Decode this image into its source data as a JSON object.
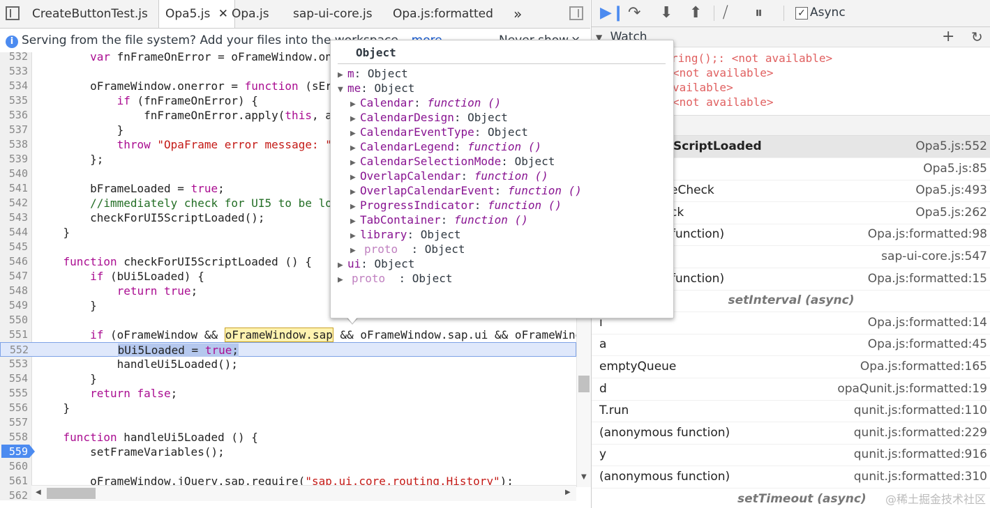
{
  "tabs": [
    "CreateButtonTest.js",
    "Opa5.js",
    "Opa.js",
    "sap-ui-core.js",
    "Opa.js:formatted"
  ],
  "tab_overflow": "»",
  "infobar": {
    "text": "Serving from the file system? Add your files into the workspace.",
    "link": "more",
    "never_show": "Never show",
    "close": "×"
  },
  "editor": {
    "lines": [
      {
        "n": "532",
        "code": "        var fnFrameOnError = oFrameWindow.onerror;"
      },
      {
        "n": "533",
        "code": ""
      },
      {
        "n": "534",
        "code": "        oFrameWindow.onerror = function (sErrorMsg, sUrl, iLine) {"
      },
      {
        "n": "535",
        "code": "            if (fnFrameOnError) {"
      },
      {
        "n": "536",
        "code": "                fnFrameOnError.apply(this, arguments);"
      },
      {
        "n": "537",
        "code": "            }"
      },
      {
        "n": "538",
        "code": "            throw \"OpaFrame error message: \" + sErrorMsg;"
      },
      {
        "n": "539",
        "code": "        };"
      },
      {
        "n": "540",
        "code": ""
      },
      {
        "n": "541",
        "code": "        bFrameLoaded = true;"
      },
      {
        "n": "542",
        "code": "        //immediately check for UI5 to be loaded, to intercept any hashchanges"
      },
      {
        "n": "543",
        "code": "        checkForUI5ScriptLoaded();"
      },
      {
        "n": "544",
        "code": "    }"
      },
      {
        "n": "545",
        "code": ""
      },
      {
        "n": "546",
        "code": "    function checkForUI5ScriptLoaded () {"
      },
      {
        "n": "547",
        "code": "        if (bUi5Loaded) {"
      },
      {
        "n": "548",
        "code": "            return true;"
      },
      {
        "n": "549",
        "code": "        }"
      },
      {
        "n": "550",
        "code": ""
      },
      {
        "n": "551",
        "code": "        if (oFrameWindow && oFrameWindow.sap && oFrameWindow.sap.ui && oFrameWindow.sap.ui.getCore) {"
      },
      {
        "n": "552",
        "code": "            bUi5Loaded = true;"
      },
      {
        "n": "553",
        "code": "            handleUi5Loaded();"
      },
      {
        "n": "554",
        "code": "        }"
      },
      {
        "n": "555",
        "code": "        return false;"
      },
      {
        "n": "556",
        "code": "    }"
      },
      {
        "n": "557",
        "code": ""
      },
      {
        "n": "558",
        "code": "    function handleUi5Loaded () {"
      },
      {
        "n": "559",
        "code": "        setFrameVariables();"
      },
      {
        "n": "560",
        "code": ""
      },
      {
        "n": "561",
        "code": "        oFrameWindow.jQuery.sap.require(\"sap.ui.core.routing.History\");"
      },
      {
        "n": "562",
        "code": ""
      }
    ]
  },
  "debug_toolbar": {
    "async_label": "Async",
    "async_checked": true
  },
  "watch": {
    "title": "Watch",
    "add": "+",
    "refresh": "↻",
    "rows": [
      "ring();: <not available>",
      "<not available>",
      "vailable>",
      "<not available>"
    ]
  },
  "call_stack": [
    {
      "fn": "ScriptLoaded",
      "loc": "Opa5.js:552",
      "selected": true
    },
    {
      "fn": "",
      "loc": "Opa5.js:85"
    },
    {
      "fn": "eCheck",
      "loc": "Opa5.js:493"
    },
    {
      "fn": "ck",
      "loc": "Opa5.js:262"
    },
    {
      "fn": "function)",
      "loc": "Opa.js:formatted:98"
    },
    {
      "fn": "",
      "loc": "sap-ui-core.js:547"
    },
    {
      "fn": "function)",
      "loc": "Opa.js:formatted:15"
    },
    {
      "async": "setInterval (async)"
    },
    {
      "fn": "i",
      "loc": "Opa.js:formatted:14"
    },
    {
      "fn": "a",
      "loc": "Opa.js:formatted:45"
    },
    {
      "fn": "emptyQueue",
      "loc": "Opa.js:formatted:165"
    },
    {
      "fn": "d",
      "loc": "opaQunit.js:formatted:19"
    },
    {
      "fn": "T.run",
      "loc": "qunit.js:formatted:110"
    },
    {
      "fn": "(anonymous function)",
      "loc": "qunit.js:formatted:229"
    },
    {
      "fn": "y",
      "loc": "qunit.js:formatted:916"
    },
    {
      "fn": "(anonymous function)",
      "loc": "qunit.js:formatted:310"
    },
    {
      "async": "setTimeout (async)"
    }
  ],
  "popover": {
    "title": "Object",
    "rows": [
      {
        "level": 0,
        "expanded": false,
        "key": "m",
        "val": "Object"
      },
      {
        "level": 0,
        "expanded": true,
        "key": "me",
        "val": "Object"
      },
      {
        "level": 1,
        "expanded": false,
        "key": "Calendar",
        "fn": "function ()"
      },
      {
        "level": 1,
        "expanded": false,
        "key": "CalendarDesign",
        "val": "Object"
      },
      {
        "level": 1,
        "expanded": false,
        "key": "CalendarEventType",
        "val": "Object"
      },
      {
        "level": 1,
        "expanded": false,
        "key": "CalendarLegend",
        "fn": "function ()"
      },
      {
        "level": 1,
        "expanded": false,
        "key": "CalendarSelectionMode",
        "val": "Object"
      },
      {
        "level": 1,
        "expanded": false,
        "key": "OverlapCalendar",
        "fn": "function ()"
      },
      {
        "level": 1,
        "expanded": false,
        "key": "OverlapCalendarEvent",
        "fn": "function ()"
      },
      {
        "level": 1,
        "expanded": false,
        "key": "ProgressIndicator",
        "fn": "function ()"
      },
      {
        "level": 1,
        "expanded": false,
        "key": "TabContainer",
        "fn": "function ()"
      },
      {
        "level": 1,
        "expanded": false,
        "key": "library",
        "val": "Object"
      },
      {
        "level": 1,
        "expanded": false,
        "key": "proto",
        "val": "Object",
        "proto": true
      },
      {
        "level": 0,
        "expanded": false,
        "key": "ui",
        "val": "Object"
      },
      {
        "level": 0,
        "expanded": false,
        "key": "proto",
        "val": "Object",
        "proto": true
      }
    ]
  },
  "watermark": "@稀土掘金技术社区"
}
